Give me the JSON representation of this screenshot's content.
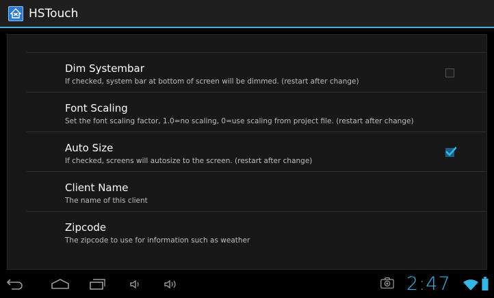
{
  "app": {
    "title": "HSTouch",
    "icon": "hstouch-logo-icon"
  },
  "preferences": [
    {
      "title": "Dim Systembar",
      "summary": "If checked, system bar at bottom of screen will be dimmed. (restart after change)",
      "checkbox": true,
      "checked": false
    },
    {
      "title": "Font Scaling",
      "summary": "Set the font scaling factor, 1.0=no scaling, 0=use scaling from project file. (restart after change)",
      "checkbox": false
    },
    {
      "title": "Auto Size",
      "summary": "If checked, screens will autosize to the screen. (restart after change)",
      "checkbox": true,
      "checked": true
    },
    {
      "title": "Client Name",
      "summary": "The name of this client",
      "checkbox": false
    },
    {
      "title": "Zipcode",
      "summary": "The zipcode to use for information such as weather",
      "checkbox": false
    }
  ],
  "navbar": {
    "buttons": [
      "back-icon",
      "home-icon",
      "recent-apps-icon",
      "volume-down-icon",
      "volume-up-icon"
    ],
    "status": {
      "time": "2:47",
      "icons": [
        "screenshot-camera-icon",
        "wifi-icon",
        "battery-icon"
      ]
    }
  },
  "colors": {
    "accent": "#33b5e5",
    "checkbox_checked": "#1e5f86",
    "background": "#000000",
    "panel": "#181818"
  }
}
